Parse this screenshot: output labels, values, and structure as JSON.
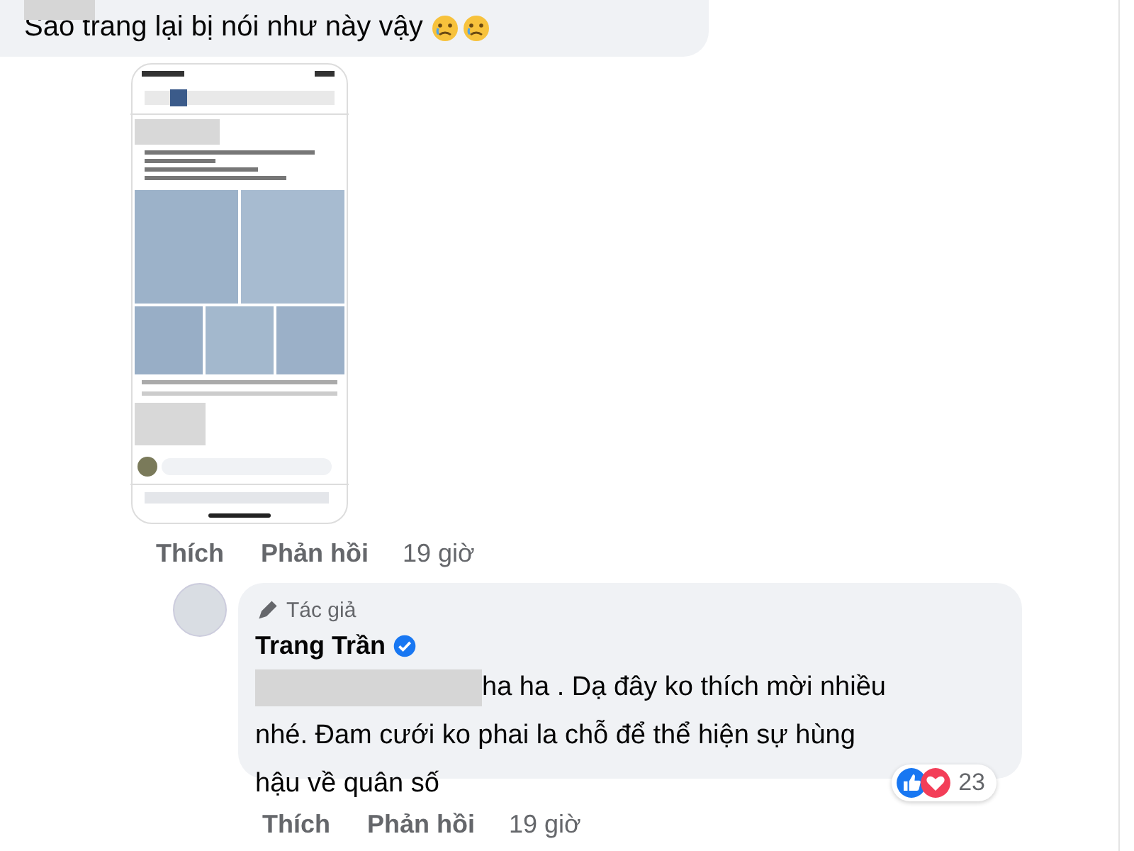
{
  "comment": {
    "text": "Sao trang lại bị nói như này vậy",
    "actions": [
      {
        "label": "Thích"
      },
      {
        "label": "Phản hồi"
      }
    ],
    "time": "19 giờ"
  },
  "reply": {
    "badge": "Tác giả",
    "author": "Trang Trần",
    "verified": true,
    "text_lines": [
      "ha ha . Dạ đây ko thích mời nhiều",
      "nhé. Đam cưới ko phai la chỗ để thể hiện sự hùng",
      "hậu về quân số"
    ],
    "reaction_count": "23",
    "actions": [
      {
        "label": "Thích"
      },
      {
        "label": "Phản hồi"
      }
    ],
    "time": "19 giờ"
  }
}
